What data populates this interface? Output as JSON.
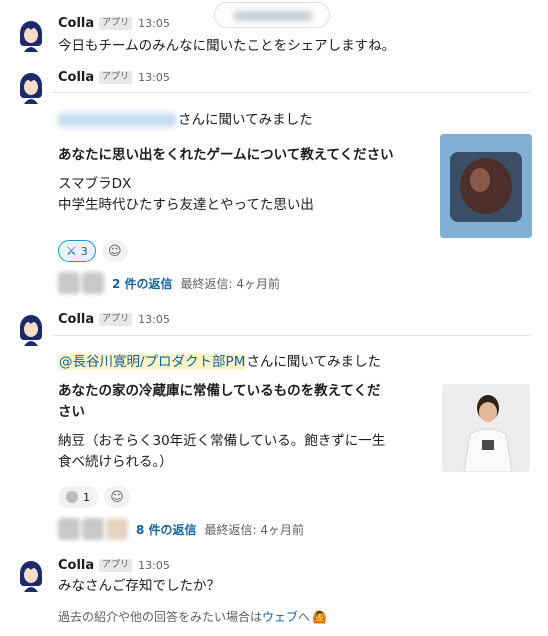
{
  "messages": [
    {
      "sender": "Colla",
      "badge": "アプリ",
      "time": "13:05",
      "text": "今日もチームのみんなに聞いたことをシェアしますね。"
    },
    {
      "sender": "Colla",
      "badge": "アプリ",
      "time": "13:05",
      "asked_suffix": "さんに聞いてみました",
      "question": "あなたに思い出をくれたゲームについて教えてください",
      "answer_lines": [
        "スマブラDX",
        "中学生時代ひたすら友達とやってた思い出"
      ],
      "reaction_count": "3",
      "reply_count": "2 件の返信",
      "last_reply": "最終返信: 4ヶ月前"
    },
    {
      "sender": "Colla",
      "badge": "アプリ",
      "time": "13:05",
      "mention": "@長谷川寛明/プロダクト部PM",
      "asked_suffix": "さんに聞いてみました",
      "question_lines": [
        "あなたの家の冷蔵庫に常備しているものを教えてくだ",
        "さい"
      ],
      "answer_lines": [
        "納豆（おそらく30年近く常備している。飽きずに一生",
        "食べ続けられる。）"
      ],
      "reaction_count": "1",
      "reply_count": "8 件の返信",
      "last_reply": "最終返信: 4ヶ月前"
    },
    {
      "sender": "Colla",
      "badge": "アプリ",
      "time": "13:05",
      "text": "みなさんご存知でしたか？",
      "footer_prefix": "過去の紹介や他の回答をみたい場合は",
      "footer_link": "ウェブ",
      "footer_suffix": "へ"
    }
  ],
  "colors": {
    "link": "#1264a3",
    "mention_bg": "#fdf3c4",
    "reaction_border": "#1d9bd1"
  }
}
